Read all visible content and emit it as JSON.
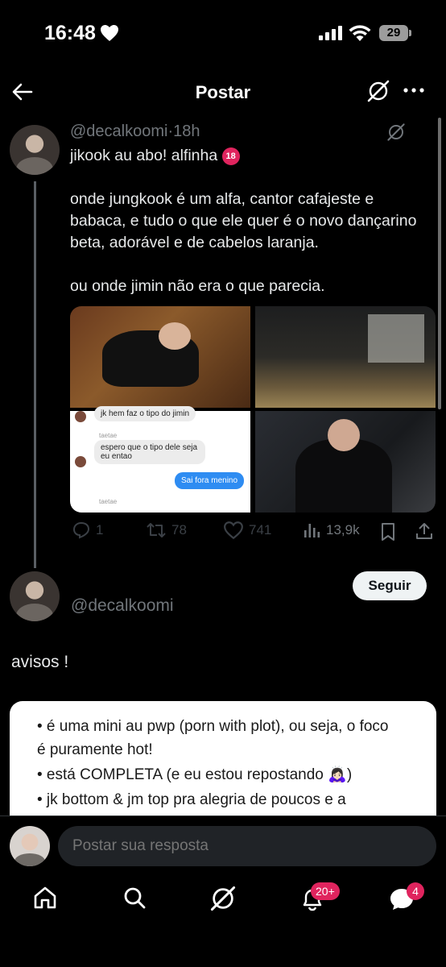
{
  "status": {
    "time": "16:48",
    "battery": "29"
  },
  "header": {
    "title": "Postar"
  },
  "post": {
    "handle": "@decalkoomi",
    "time": "18h",
    "line1": "jikook au abo! alfinha",
    "line1_badge": "18",
    "body": "onde jungkook é um alfa, cantor cafajeste e babaca, e tudo o que ele quer é o novo dançarino beta, adorável e de cabelos laranja.\n\nou onde jimin não era o que parecia.",
    "chat": {
      "line_top": "jk hem faz o tipo do jimin",
      "sender": "taetae",
      "msg1": "espero que o tipo dele seja eu entao",
      "msg2": "Sai fora menino",
      "sender2": "taetae"
    },
    "actions": {
      "replies": "1",
      "reposts": "78",
      "likes": "741",
      "views": "13,9k"
    }
  },
  "thread_reply": {
    "handle": "@decalkoomi",
    "follow_label": "Seguir",
    "heading": "avisos !",
    "notes": [
      "• é uma mini au pwp (porn with plot), ou seja, o foco",
      "é puramente hot!",
      "• está COMPLETA (e eu estou repostando 🙇🏻‍♀️)",
      "• jk bottom & jm top pra alegria de poucos e a"
    ]
  },
  "reply_box": {
    "placeholder": "Postar sua resposta"
  },
  "nav": {
    "notifications_badge": "20+",
    "messages_badge": "4"
  },
  "colors": {
    "background": "#000000",
    "text": "#e7e9ea",
    "muted": "#71767b",
    "badge": "#e0245e",
    "chat_blue": "#2e8cf2"
  }
}
